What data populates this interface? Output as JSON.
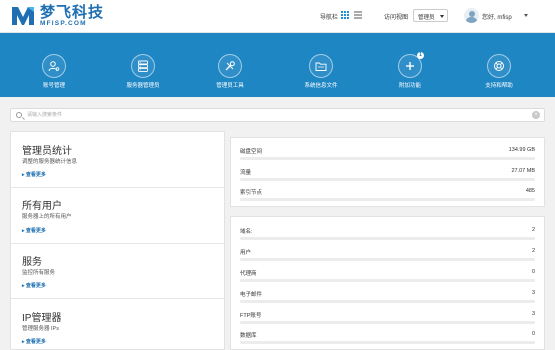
{
  "brand": {
    "name_cn": "梦飞科技",
    "name_en": "MFISP.COM"
  },
  "header": {
    "nav_label": "导航栏",
    "goto_label": "访问视图",
    "role_select": "管理员",
    "greeting": "您好, mfisp"
  },
  "shortcuts": [
    {
      "icon": "user-gear-icon",
      "label": "账号管理"
    },
    {
      "icon": "server-icon",
      "label": "服务器管理员"
    },
    {
      "icon": "tools-icon",
      "label": "管理员工具"
    },
    {
      "icon": "folder-icon",
      "label": "系统信息文件"
    },
    {
      "icon": "plus-icon",
      "label": "附加功能",
      "badge": "1"
    },
    {
      "icon": "support-icon",
      "label": "支持和帮助"
    }
  ],
  "search": {
    "placeholder": "请输入搜索条件"
  },
  "sections": [
    {
      "title": "管理员统计",
      "subtitle": "调整的服务器统计信息",
      "more": "查看更多"
    },
    {
      "title": "所有用户",
      "subtitle": "服务器上的所有用户",
      "more": "查看更多"
    },
    {
      "title": "服务",
      "subtitle": "监控所有服务",
      "more": "查看更多"
    },
    {
      "title": "IP管理器",
      "subtitle": "管理服务器 IPs",
      "more": "查看更多"
    }
  ],
  "usage": [
    {
      "label": "磁盘空间",
      "value": "134.99 GB",
      "fill": 0
    },
    {
      "label": "流量",
      "value": "27.07 MB",
      "fill": 0
    },
    {
      "label": "索引节点",
      "value": "485",
      "fill": 0
    }
  ],
  "counts": [
    {
      "label": "域名:",
      "value": "2",
      "fill": 0
    },
    {
      "label": "用户",
      "value": "2",
      "fill": 0
    },
    {
      "label": "代理商",
      "value": "0",
      "fill": 0
    },
    {
      "label": "电子邮件",
      "value": "3",
      "fill": 0
    },
    {
      "label": "FTP账号",
      "value": "3",
      "fill": 0
    },
    {
      "label": "数据库",
      "value": "0",
      "fill": 0
    }
  ],
  "colors": {
    "brand": "#1f6fb2",
    "banner": "#1f86c4",
    "page_bg": "#f1f1f1"
  }
}
